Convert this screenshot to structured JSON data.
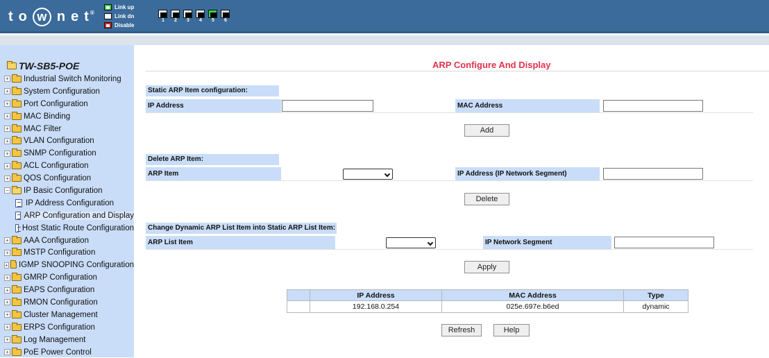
{
  "header": {
    "logo_letters": "to",
    "logo_circle": "w",
    "logo_rest": "net",
    "logo_tm": "®",
    "legend": [
      {
        "label": "Link up",
        "color": "#39d24a"
      },
      {
        "label": "Link dn",
        "color": "#f0f0f0"
      },
      {
        "label": "Disable",
        "color": "#e02020"
      }
    ],
    "ports": [
      "1",
      "2",
      "3",
      "4",
      "5",
      "6"
    ]
  },
  "sidebar": {
    "title": "TW-SB5-POE",
    "items": [
      {
        "label": "Industrial Switch Monitoring"
      },
      {
        "label": "System Configuration"
      },
      {
        "label": "Port Configuration"
      },
      {
        "label": "MAC Binding"
      },
      {
        "label": "MAC Filter"
      },
      {
        "label": "VLAN Configuration"
      },
      {
        "label": "SNMP Configuration"
      },
      {
        "label": "ACL Configuration"
      },
      {
        "label": "QOS Configuration"
      },
      {
        "label": "IP Basic Configuration"
      },
      {
        "label": "IP Address Configuration"
      },
      {
        "label": "ARP Configuration and Display"
      },
      {
        "label": "Host Static Route Configuration"
      },
      {
        "label": "AAA Configuration"
      },
      {
        "label": "MSTP Configuration"
      },
      {
        "label": "IGMP SNOOPING Configuration"
      },
      {
        "label": "GMRP Configuration"
      },
      {
        "label": "EAPS Configuration"
      },
      {
        "label": "RMON Configuration"
      },
      {
        "label": "Cluster Management"
      },
      {
        "label": "ERPS Configuration"
      },
      {
        "label": "Log Management"
      },
      {
        "label": "PoE Power Control"
      }
    ]
  },
  "main": {
    "title": "ARP Configure And Display",
    "static": {
      "heading": "Static ARP Item configuration:",
      "ip_label": "IP Address",
      "ip_value": "",
      "mac_label": "MAC Address",
      "mac_value": "",
      "add_button": "Add"
    },
    "delete": {
      "heading": "Delete ARP Item:",
      "item_label": "ARP Item",
      "item_selected": "",
      "segment_label": "IP Address (IP Network Segment)",
      "segment_value": "",
      "delete_button": "Delete"
    },
    "change": {
      "heading": "Change Dynamic ARP List Item into Static ARP List Item:",
      "list_label": "ARP List Item",
      "list_selected": "",
      "segment_label": "IP Network Segment",
      "segment_value": "",
      "apply_button": "Apply"
    },
    "table": {
      "columns": [
        "",
        "IP Address",
        "MAC Address",
        "Type"
      ],
      "rows": [
        {
          "check": "",
          "ip": "192.168.0.254",
          "mac": "025e.697e.b6ed",
          "type": "dynamic"
        }
      ]
    },
    "refresh_button": "Refresh",
    "help_button": "Help"
  }
}
